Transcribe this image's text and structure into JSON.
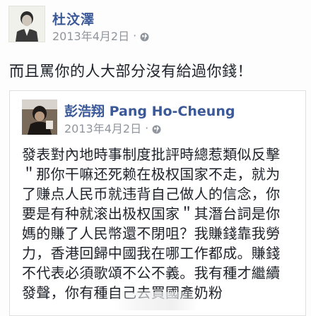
{
  "post": {
    "author": "杜汶澤",
    "date": "2013年4月2日",
    "dot": "·",
    "text": "而且罵你的人大部分沒有給過你錢！"
  },
  "shared": {
    "author": "彭浩翔 Pang Ho-Cheung",
    "date": "2013年4月2日",
    "dot": "·",
    "lines": [
      "發表對內地時事制度批評時總惹類似反擊",
      "＂那你干嘛还死赖在极权国家不走，就为",
      "了赚点人民币就违背自己做人的信念，你",
      "要是有种就滚出极权国家＂其潛台詞是你",
      "媽的賺了人民幣還不閉咀？我賺錢靠我勞",
      "力，香港回歸中國我在哪工作都成。賺錢",
      "不代表必須歌頌不公不義。我有種才繼續",
      "發聲，你有種自己去買國產奶粉"
    ]
  },
  "icons": {
    "audience": "globe-icon"
  }
}
